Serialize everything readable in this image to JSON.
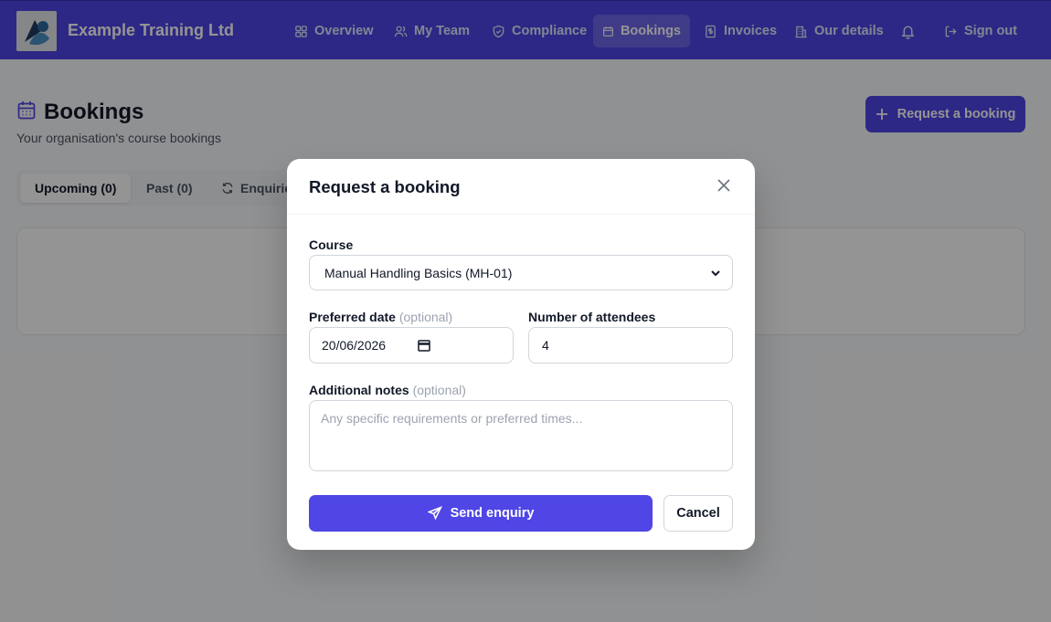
{
  "header": {
    "brand": "Example Training Ltd",
    "nav": [
      {
        "label": "Overview",
        "icon": "grid-icon"
      },
      {
        "label": "My Team",
        "icon": "users-icon"
      },
      {
        "label": "Compliance",
        "icon": "shield-icon"
      },
      {
        "label": "Bookings",
        "icon": "calendar-icon",
        "active": true
      },
      {
        "label": "Invoices",
        "icon": "receipt-icon"
      },
      {
        "label": "Our details",
        "icon": "building-icon"
      },
      {
        "label": "Sign out",
        "icon": "sign-out-icon"
      }
    ],
    "notifications_icon": "bell-icon"
  },
  "page": {
    "title": "Bookings",
    "subtitle": "Your organisation's course bookings",
    "request_button": "Request a booking",
    "tabs": [
      {
        "label": "Upcoming (0)",
        "active": true
      },
      {
        "label": "Past (0)"
      },
      {
        "label": "Enquiries",
        "icon": "refresh-icon"
      }
    ]
  },
  "modal": {
    "title": "Request a booking",
    "course_label": "Course",
    "course_value": "Manual Handling Basics (MH-01)",
    "date_label": "Preferred date",
    "optional": "(optional)",
    "date_value": "20/06/2026",
    "attendees_label": "Number of attendees",
    "attendees_value": "4",
    "notes_label": "Additional notes",
    "notes_placeholder": "Any specific requirements or preferred times...",
    "send_button": "Send enquiry",
    "cancel_button": "Cancel"
  },
  "colors": {
    "primary": "#4f46e5",
    "overlay": "rgba(0,0,0,0.42)"
  }
}
